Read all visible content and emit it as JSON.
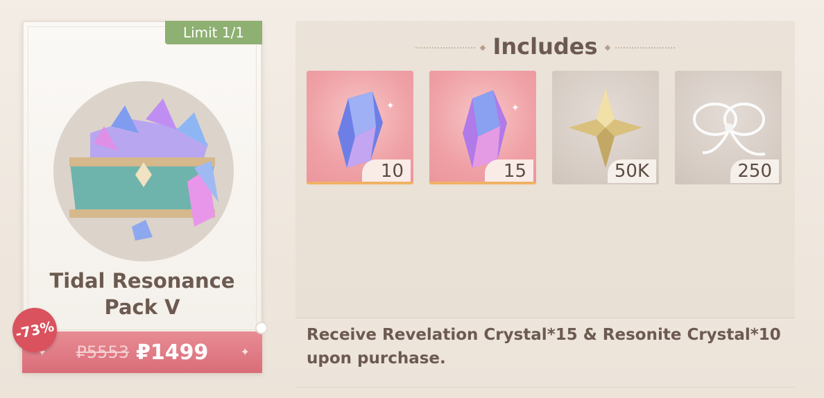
{
  "pack": {
    "limit": "Limit 1/1",
    "title_line1": "Tidal Resonance",
    "title_line2": "Pack V",
    "discount": "-73%",
    "original_price": "₽5553",
    "price": "₽1499"
  },
  "includes": {
    "heading": "Includes",
    "items": [
      {
        "icon": "revelation-crystal-icon",
        "quantity": "10"
      },
      {
        "icon": "resonite-crystal-icon",
        "quantity": "15"
      },
      {
        "icon": "gold-star-icon",
        "quantity": "50K"
      },
      {
        "icon": "silver-bow-icon",
        "quantity": "250"
      }
    ]
  },
  "description": "Receive Revelation Crystal*15 & Resonite Crystal*10 upon purchase.",
  "colors": {
    "limit_badge": "#8eb072",
    "price_bar": "#d96d78",
    "discount_badge": "#d9525e",
    "text": "#6c5a50"
  }
}
